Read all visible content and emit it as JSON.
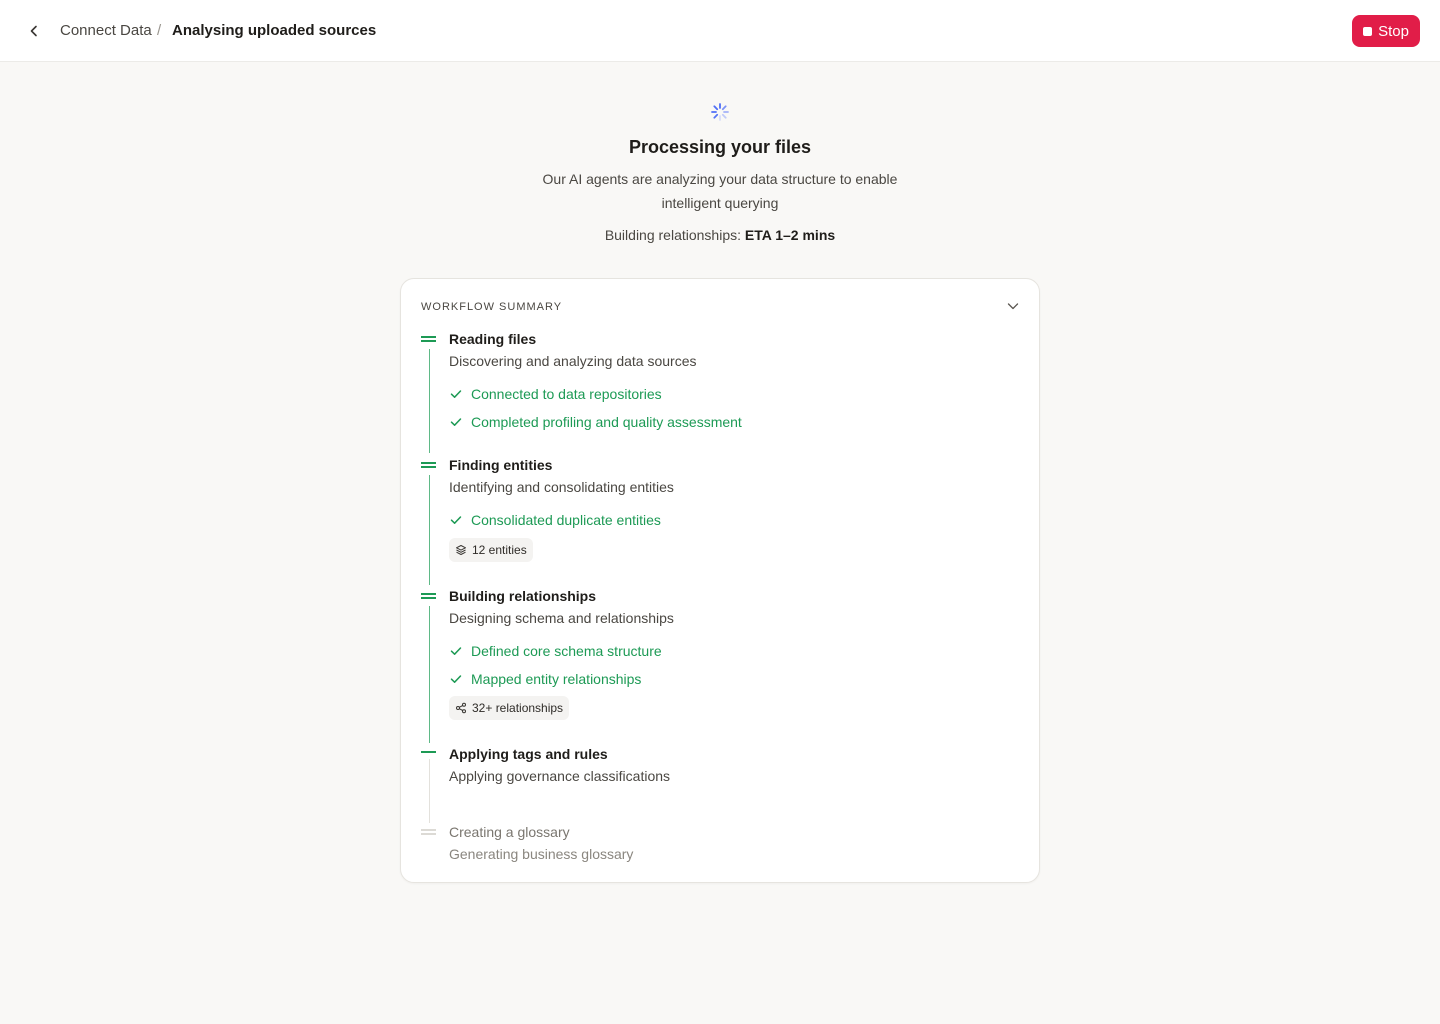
{
  "header": {
    "breadcrumb_parent": "Connect Data",
    "breadcrumb_separator": "/",
    "breadcrumb_current": "Analysing uploaded sources",
    "stop_label": "Stop"
  },
  "status": {
    "title": "Processing your files",
    "subtitle": "Our AI agents are analyzing your data structure to enable intelligent querying",
    "eta_label": "Building relationships:",
    "eta_value": "ETA 1–2 mins"
  },
  "workflow": {
    "title": "WORKFLOW SUMMARY",
    "steps": [
      {
        "title": "Reading files",
        "description": "Discovering and analyzing data sources",
        "checks": [
          "Connected to data repositories",
          "Completed profiling and quality assessment"
        ],
        "state": "done"
      },
      {
        "title": "Finding entities",
        "description": "Identifying and consolidating entities",
        "checks": [
          "Consolidated duplicate entities"
        ],
        "chip": "12 entities",
        "state": "done"
      },
      {
        "title": "Building relationships",
        "description": "Designing schema and relationships",
        "checks": [
          "Defined core schema structure",
          "Mapped entity relationships"
        ],
        "chip": "32+ relationships",
        "state": "done"
      },
      {
        "title": "Applying tags and rules",
        "description": "Applying governance classifications",
        "state": "in-progress"
      },
      {
        "title": "Creating a glossary",
        "description": "Generating business glossary",
        "state": "pending"
      }
    ]
  },
  "colors": {
    "accent_green": "#1d9a55",
    "stop_red": "#e11d48",
    "spinner_blue": "#4f6ef7"
  },
  "icons": {
    "back": "chevron-left-icon",
    "stop": "stop-square-icon",
    "spinner": "loading-spinner-icon",
    "collapse": "chevron-down-icon",
    "check": "check-icon",
    "entities": "layers-icon",
    "relationships": "share-icon"
  }
}
